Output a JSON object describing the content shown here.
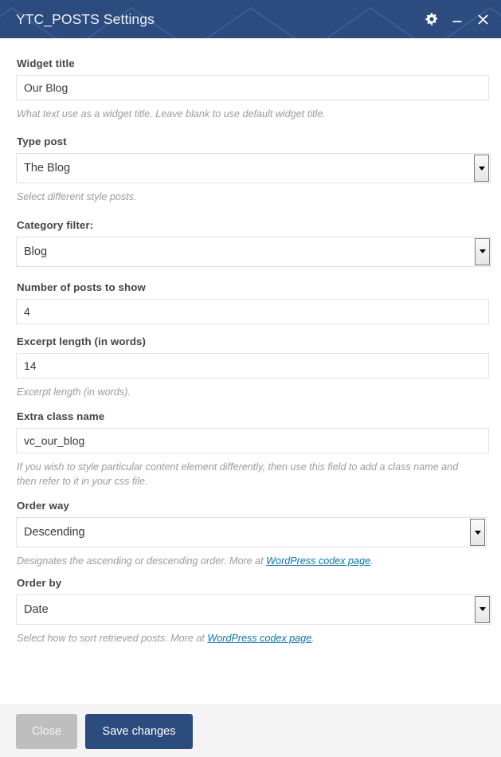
{
  "window": {
    "title": "YTC_POSTS Settings",
    "header_color": "#2c4b7e",
    "actions": [
      {
        "name": "settings-icon",
        "label": "Settings"
      },
      {
        "name": "minimize-icon",
        "label": "Minimize"
      },
      {
        "name": "close-icon",
        "label": "Close"
      }
    ]
  },
  "fields": {
    "widget_title": {
      "label": "Widget title",
      "value": "Our Blog",
      "placeholder": "",
      "description": "What text use as a widget title. Leave blank to use default widget title."
    },
    "type_post": {
      "label": "Type post",
      "value": "The Blog",
      "description": "Select different style posts.",
      "options": [
        "The Blog"
      ]
    },
    "category_filter": {
      "label": "Category filter:",
      "value": "Blog",
      "description": "",
      "options": [
        "Blog"
      ]
    },
    "posts_number": {
      "label": "Number of posts to show",
      "value": "4",
      "placeholder": "",
      "description": ""
    },
    "excerpt_length": {
      "label": "Excerpt length (in words)",
      "value": "14",
      "placeholder": "",
      "description": "Excerpt length (in words)."
    },
    "extra_class": {
      "label": "Extra class name",
      "value": "vc_our_blog",
      "placeholder": "",
      "description": "If you wish to style particular content element differently, then use this field to add a class name and then refer to it in your css file."
    },
    "order_way": {
      "label": "Order way",
      "value": "Descending",
      "options": [
        "Descending"
      ],
      "description_before": "Designates the ascending or descending order. More at ",
      "link_text": "WordPress codex page",
      "description_after": "."
    },
    "order_by": {
      "label": "Order by",
      "value": "Date",
      "options": [
        "Date"
      ],
      "description_before": "Select how to sort retrieved posts. More at ",
      "link_text": "WordPress codex page",
      "description_after": "."
    }
  },
  "footer": {
    "close_label": "Close",
    "save_label": "Save changes",
    "close_color": "#bebebe",
    "save_color": "#2c4b7e"
  }
}
